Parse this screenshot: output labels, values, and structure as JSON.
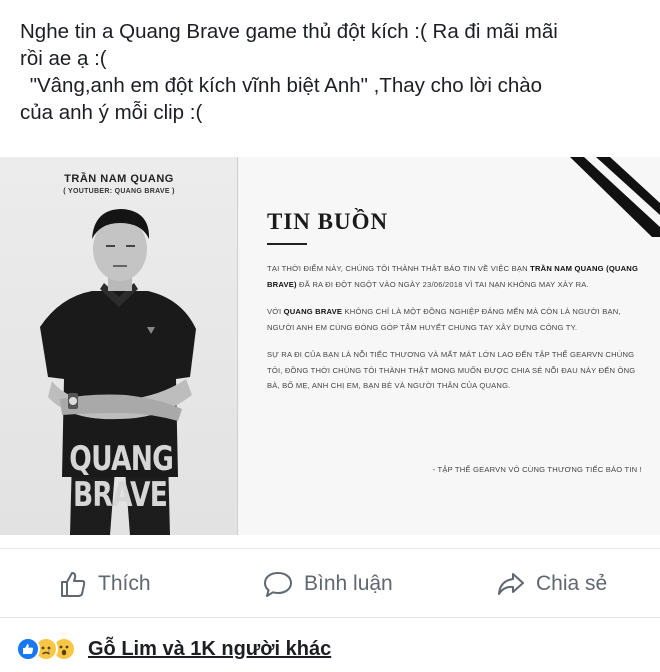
{
  "post": {
    "line1": "Nghe tin a Quang Brave game thủ đột kích :( Ra đi mãi mãi",
    "line2": "rồi ae ạ :(",
    "line3": " \"Vâng,anh em đột kích vĩnh biệt Anh\" ,Thay cho lời chào",
    "line4": "của anh ý mỗi clip :("
  },
  "image": {
    "photo_name": "TRẦN NAM QUANG",
    "photo_sub": "( YOUTUBER: QUANG BRAVE )",
    "brand_line1": "QUANG",
    "brand_line2": "BRAVE",
    "notice_title": "TIN BUỒN",
    "para1_a": "TẠI THỜI ĐIỂM NÀY, CHÚNG TÔI THÀNH THẬT BÁO TIN VỀ VIỆC BẠN ",
    "para1_name": "TRẦN NAM QUANG (QUANG BRAVE)",
    "para1_b": " ĐÃ RA ĐI ĐỘT NGỘT VÀO NGÀY 23/06/2018 VÌ TAI NẠN KHÔNG MAY XẢY RA.",
    "para2_a": "VỚI ",
    "para2_name": "QUANG BRAVE",
    "para2_b": " KHÔNG CHỈ LÀ MỘT ĐỒNG NGHIỆP ĐÁNG MẾN MÀ CÒN LÀ NGƯỜI BẠN, NGƯỜI ANH EM CÙNG ĐÓNG GÓP TÂM HUYẾT CHUNG TAY XÂY DỰNG CÔNG TY.",
    "para3": "SỰ RA ĐI CỦA BẠN LÀ NỖI TIẾC THƯƠNG VÀ MẤT MÁT LỚN LAO ĐẾN TẬP THỂ GEARVN CHÚNG TÔI, ĐỒNG THỜI CHÚNG TÔI THÀNH THẬT MONG MUỐN ĐƯỢC CHIA SẺ NỖI ĐAU NÀY ĐẾN ÔNG BÀ, BỐ MẸ, ANH CHỊ EM, BẠN BÈ VÀ NGƯỜI THÂN CỦA QUANG.",
    "signature": "- TẬP THỂ GEARVN VÔ CÙNG THƯƠNG TIẾC BÁO TIN !"
  },
  "actions": {
    "like": "Thích",
    "comment": "Bình luận",
    "share": "Chia sẻ"
  },
  "reactions": {
    "text": "Gỗ Lim và 1K người khác",
    "icons": [
      "like-reaction-icon",
      "sad-reaction-icon",
      "wow-reaction-icon"
    ]
  },
  "colors": {
    "action_text": "#606770",
    "like_blue": "#1877f2",
    "reaction_yellow": "#f7c644"
  }
}
